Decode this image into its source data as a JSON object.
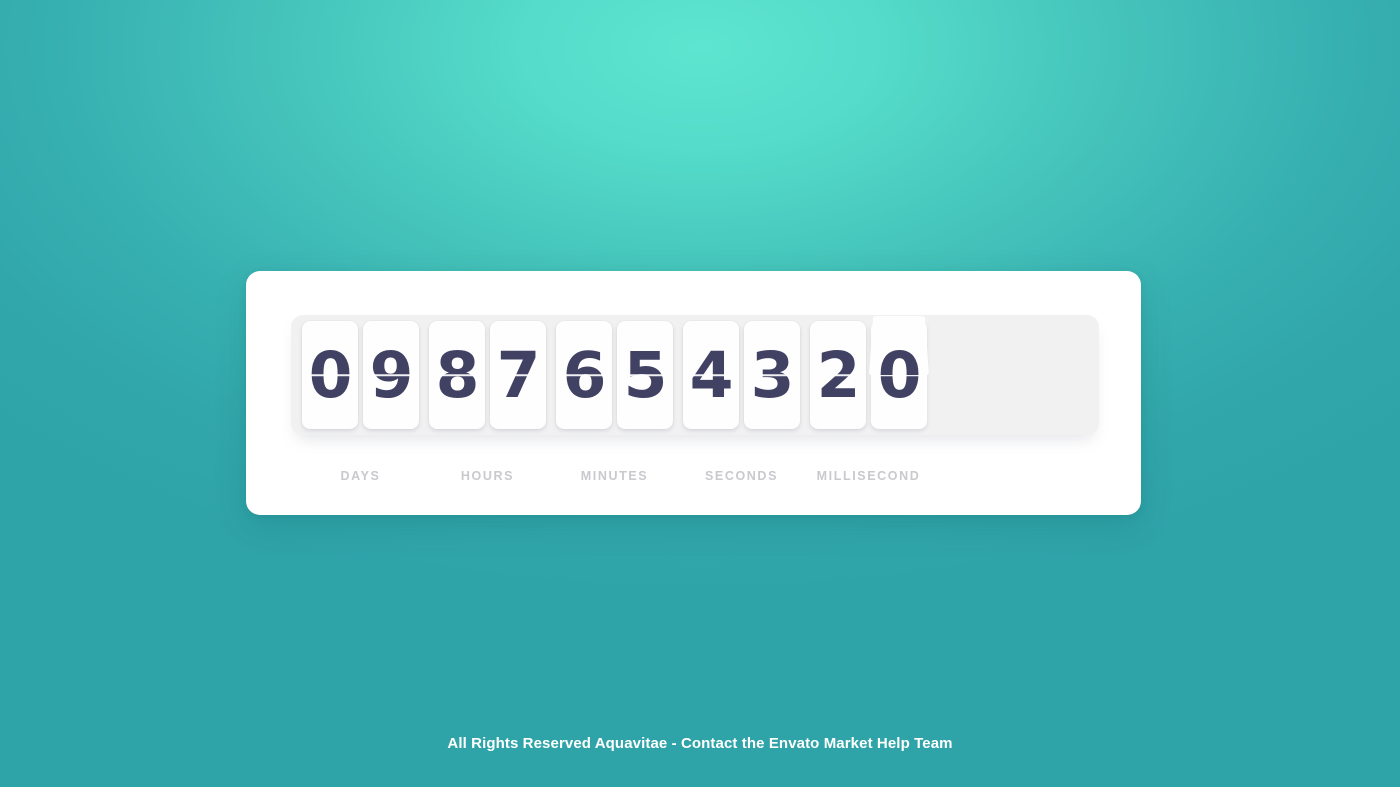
{
  "background": {
    "gradient_center": "#5EE5D0",
    "gradient_edge": "#2EA3A8"
  },
  "countdown": {
    "digit_color": "#414163",
    "card_background": "#FEFEFE",
    "track_background": "#F1F1F2",
    "panel_background": "#FFFFFF",
    "label_color": "#C9C9CE",
    "groups": [
      {
        "unit": "DAYS",
        "digits": [
          "0",
          "9"
        ]
      },
      {
        "unit": "HOURS",
        "digits": [
          "8",
          "7"
        ]
      },
      {
        "unit": "MINUTES",
        "digits": [
          "6",
          "5"
        ]
      },
      {
        "unit": "SECONDS",
        "digits": [
          "4",
          "3"
        ]
      },
      {
        "unit": "MILLISECOND",
        "digits": [
          "2",
          "0"
        ]
      }
    ],
    "flipping_digit_index": 9
  },
  "footer": {
    "text": "All Rights Reserved Aquavitae - Contact the Envato Market Help Team"
  }
}
